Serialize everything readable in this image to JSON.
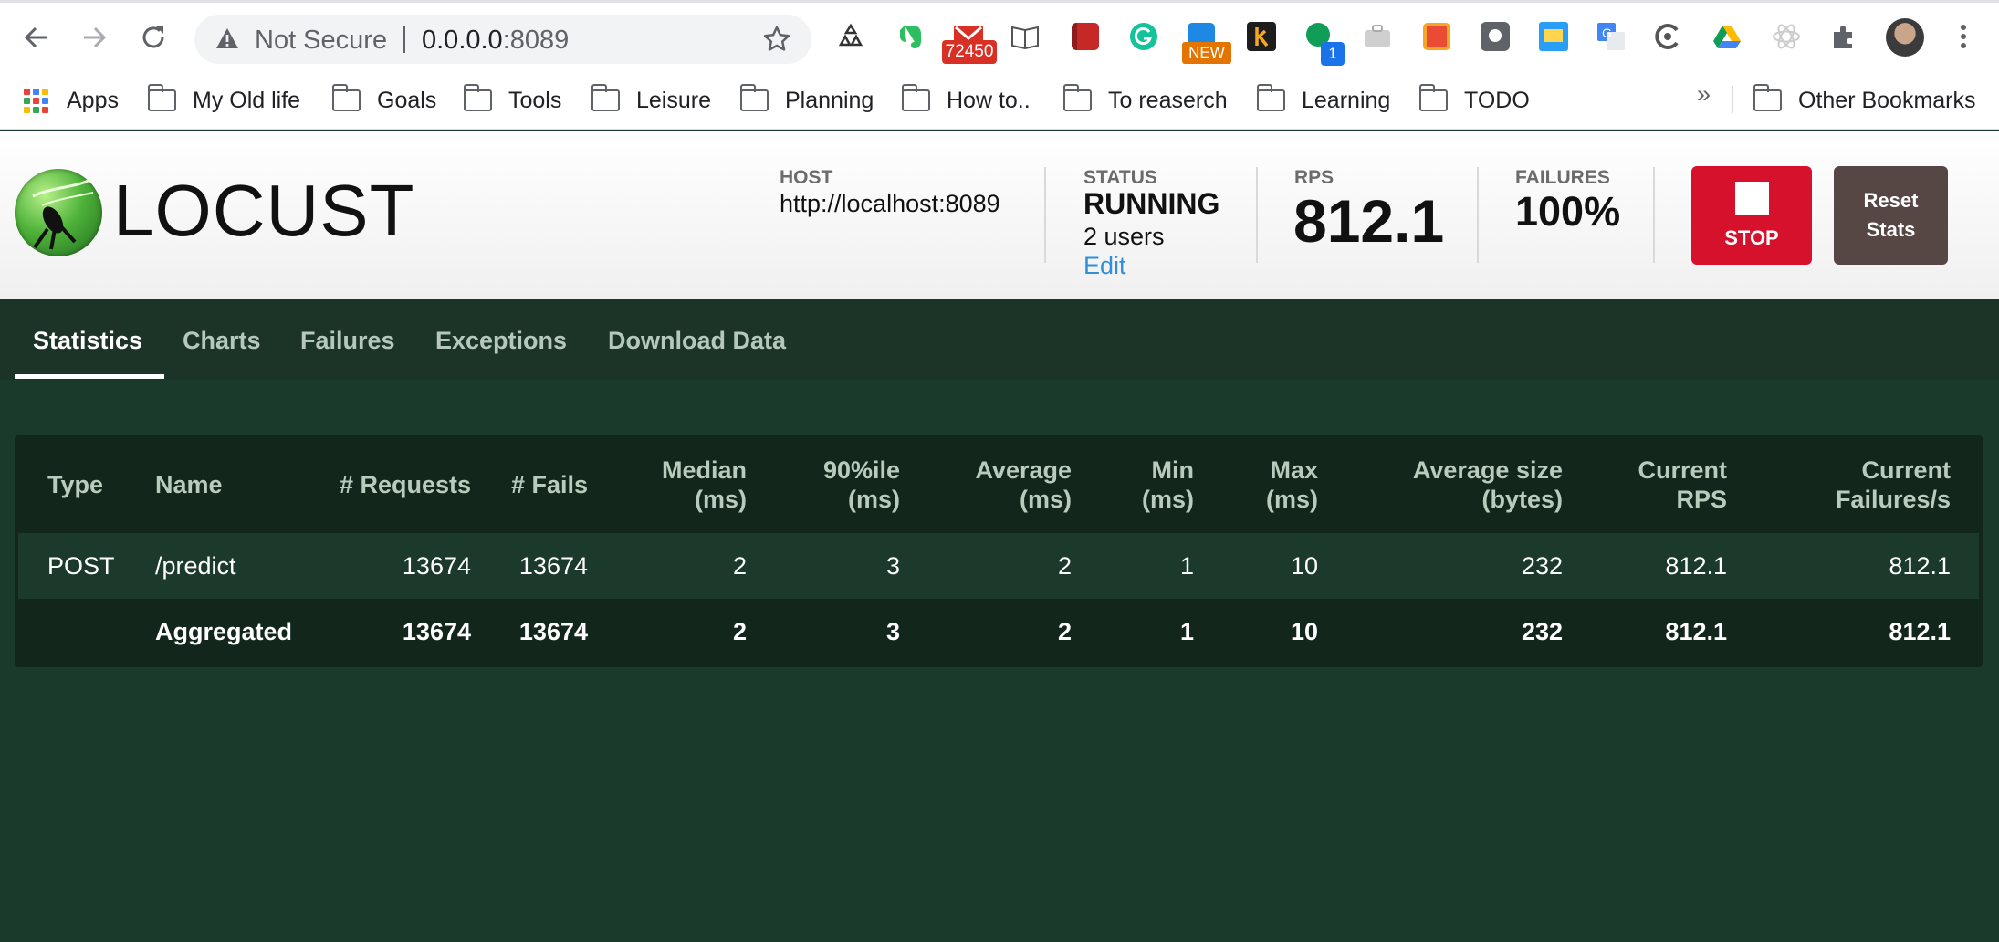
{
  "browser": {
    "security_label": "Not Secure",
    "url_host": "0.0.0.0",
    "url_port": ":8089",
    "gmail_count": "72450",
    "new_badge": "NEW",
    "ext_count": "1"
  },
  "bookmarks": {
    "apps": "Apps",
    "items": [
      "My Old life",
      "Goals",
      "Tools",
      "Leisure",
      "Planning",
      "How to..",
      "To reaserch",
      "Learning",
      "TODO"
    ],
    "more": "»",
    "other": "Other Bookmarks"
  },
  "header": {
    "logo": "LOCUST",
    "host_label": "HOST",
    "host_value": "http://localhost:8089",
    "status_label": "STATUS",
    "status_value": "RUNNING",
    "users": "2 users",
    "edit": "Edit",
    "rps_label": "RPS",
    "rps_value": "812.1",
    "failures_label": "FAILURES",
    "failures_value": "100%",
    "stop_label": "STOP",
    "reset_line1": "Reset",
    "reset_line2": "Stats"
  },
  "tabs": [
    "Statistics",
    "Charts",
    "Failures",
    "Exceptions",
    "Download Data"
  ],
  "table": {
    "headers": [
      [
        "Type"
      ],
      [
        "Name"
      ],
      [
        "# Requests"
      ],
      [
        "# Fails"
      ],
      [
        "Median",
        "(ms)"
      ],
      [
        "90%ile",
        "(ms)"
      ],
      [
        "Average",
        "(ms)"
      ],
      [
        "Min",
        "(ms)"
      ],
      [
        "Max",
        "(ms)"
      ],
      [
        "Average size",
        "(bytes)"
      ],
      [
        "Current",
        "RPS"
      ],
      [
        "Current",
        "Failures/s"
      ]
    ],
    "rows": [
      [
        "POST",
        "/predict",
        "13674",
        "13674",
        "2",
        "3",
        "2",
        "1",
        "10",
        "232",
        "812.1",
        "812.1"
      ],
      [
        "",
        "Aggregated",
        "13674",
        "13674",
        "2",
        "3",
        "2",
        "1",
        "10",
        "232",
        "812.1",
        "812.1"
      ]
    ]
  },
  "colors": {
    "stop": "#d5112b",
    "reset": "#564744",
    "page_bg": "#1a3a2c",
    "edit_link": "#2f8fd8"
  }
}
